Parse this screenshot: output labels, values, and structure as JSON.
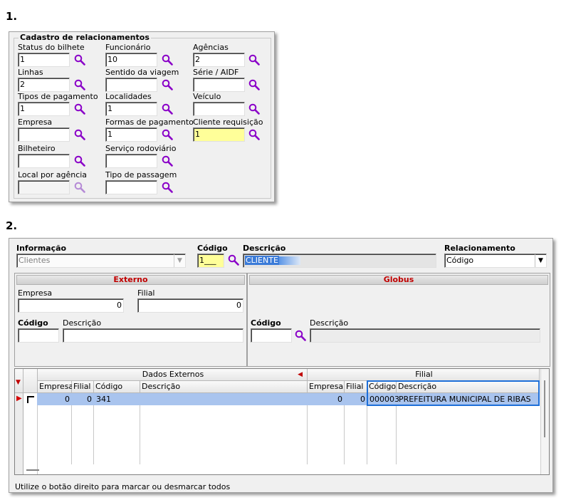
{
  "steps": {
    "one": "1.",
    "two": "2."
  },
  "panel1": {
    "title": "Cadastro de relacionamentos",
    "fields": {
      "status_bilhete": {
        "label": "Status do bilhete",
        "value": "1"
      },
      "funcionario": {
        "label": "Funcionário",
        "value": "10"
      },
      "agencias": {
        "label": "Agências",
        "value": "2"
      },
      "linhas": {
        "label": "Linhas",
        "value": "2"
      },
      "sentido_viagem": {
        "label": "Sentido da viagem",
        "value": ""
      },
      "serie_aidf": {
        "label": "Série / AIDF",
        "value": ""
      },
      "tipos_pagamento": {
        "label": "Tipos de pagamento",
        "value": "1"
      },
      "localidades": {
        "label": "Localidades",
        "value": "1"
      },
      "veiculo": {
        "label": "Veículo",
        "value": ""
      },
      "empresa": {
        "label": "Empresa",
        "value": ""
      },
      "formas_pagamento": {
        "label": "Formas de pagamento",
        "value": "1"
      },
      "cliente_requisicao": {
        "label": "Cliente requisição",
        "value": "1"
      },
      "bilheteiro": {
        "label": "Bilheteiro",
        "value": ""
      },
      "servico_rodoviario": {
        "label": "Serviço rodoviário",
        "value": ""
      },
      "local_agencia": {
        "label": "Local por agência",
        "value": ""
      },
      "tipo_passagem": {
        "label": "Tipo de passagem",
        "value": ""
      }
    }
  },
  "panel2": {
    "informacao_label": "Informação",
    "informacao_value": "Clientes",
    "codigo_label": "Código",
    "codigo_value": "1___",
    "descricao_label": "Descrição",
    "descricao_value": "CLIENTE",
    "relacionamento_label": "Relacionamento",
    "relacionamento_value": "Código",
    "externo": {
      "title": "Externo",
      "empresa_label": "Empresa",
      "empresa_value": "0",
      "filial_label": "Filial",
      "filial_value": "0",
      "codigo_label": "Código",
      "codigo_value": "",
      "descricao_label": "Descrição",
      "descricao_value": ""
    },
    "globus": {
      "title": "Globus",
      "codigo_label": "Código",
      "codigo_value": "",
      "descricao_label": "Descrição",
      "descricao_value": ""
    },
    "grid": {
      "group_externo": "Dados Externos",
      "group_filial": "Filial",
      "columns": [
        "Empresa",
        "Filial",
        "Código",
        "Descrição",
        "Empresa",
        "Filial",
        "Código",
        "Descrição"
      ],
      "row": {
        "empresa": "0",
        "filial": "0",
        "codigo": "341",
        "descricao": "",
        "empresa2": "0",
        "filial2": "0",
        "codigo2": "000003",
        "descricao2": "PREFEITURA MUNICIPAL DE RIBAS"
      }
    },
    "status_text": "Utilize o botão direito para marcar ou desmarcar todos"
  },
  "colors": {
    "accent_highlight": "#1e6fd8",
    "selected_row": "#a9c4ee",
    "label_red": "#c00000",
    "magnifier": "#8a00c8"
  }
}
